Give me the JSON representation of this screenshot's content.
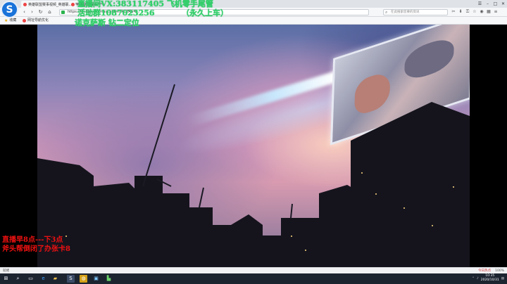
{
  "browser": {
    "tabs": [
      {
        "label": "英雄联盟赛事视频_英雄联..."
      },
      {
        "label": "英雄联盟赛事"
      }
    ],
    "address": "https://lol.qq.com/main.shtml?ADTAG=...",
    "search_placeholder": "在此搜索您要的资讯",
    "bookmarks": [
      {
        "label": "收藏"
      },
      {
        "label": "网址导航优化"
      }
    ],
    "colors": {
      "accent": "#1a73d9",
      "secure": "#2bb24c"
    }
  },
  "overlay": {
    "line1": "直播间VX:383117405 飞机零手尾管",
    "line2": "活动群1087023256",
    "line2_suffix": "（永久上车）",
    "line3": "诺克萨斯 钻二定位",
    "bottom1": "直播早8点---下3点",
    "bottom2": "斧头帮倒闭了办张卡8",
    "green_color": "#33d26b",
    "red_color": "#e11111"
  },
  "statusbar": {
    "left": "就绪",
    "hot": "今日热点",
    "zoom": "100%"
  },
  "taskbar": {
    "time": "10:35",
    "date": "2020/10/31"
  }
}
